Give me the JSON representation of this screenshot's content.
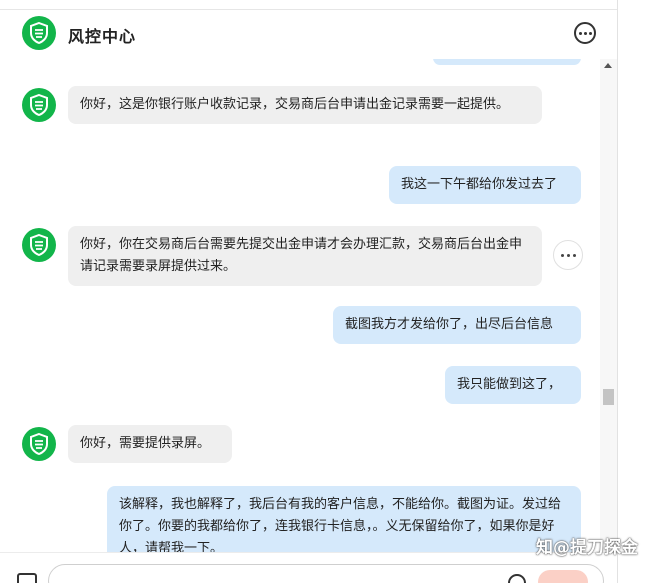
{
  "header": {
    "title": "风控中心",
    "logo_icon": "shield-icon",
    "more_icon": "more-horizontal-icon"
  },
  "messages": [
    {
      "side": "in",
      "text": "你好，这是你银行账户收款记录，交易商后台申请出金记录需要一起提供。"
    },
    {
      "side": "out",
      "text": "我这一下午都给你发过去了"
    },
    {
      "side": "in",
      "text": "你好，你在交易商后台需要先提交出金申请才会办理汇款，交易商后台出金申请记录需要录屏提供过来。"
    },
    {
      "side": "out",
      "text": "截图我方才发给你了，出尽后台信息"
    },
    {
      "side": "out",
      "text": "我只能做到这了，"
    },
    {
      "side": "in",
      "text": "你好，需要提供录屏。"
    },
    {
      "side": "out",
      "text": "该解释，我也解释了，我后台有我的客户信息，不能给你。截图为证。发过给你了。你要的我都给你了，连我银行卡信息，。义无保留给你了，如果你是好人，请帮我一下。"
    }
  ],
  "input": {
    "attach_icon": "image-attach-icon",
    "emoji_icon": "emoji-icon",
    "send_label": ""
  },
  "watermark": {
    "text": "知@提刀探金"
  },
  "colors": {
    "brand_green": "#12b54a",
    "incoming_bubble": "#efefef",
    "outgoing_bubble": "#d5e9fb",
    "send_button": "#fbd0c6"
  }
}
